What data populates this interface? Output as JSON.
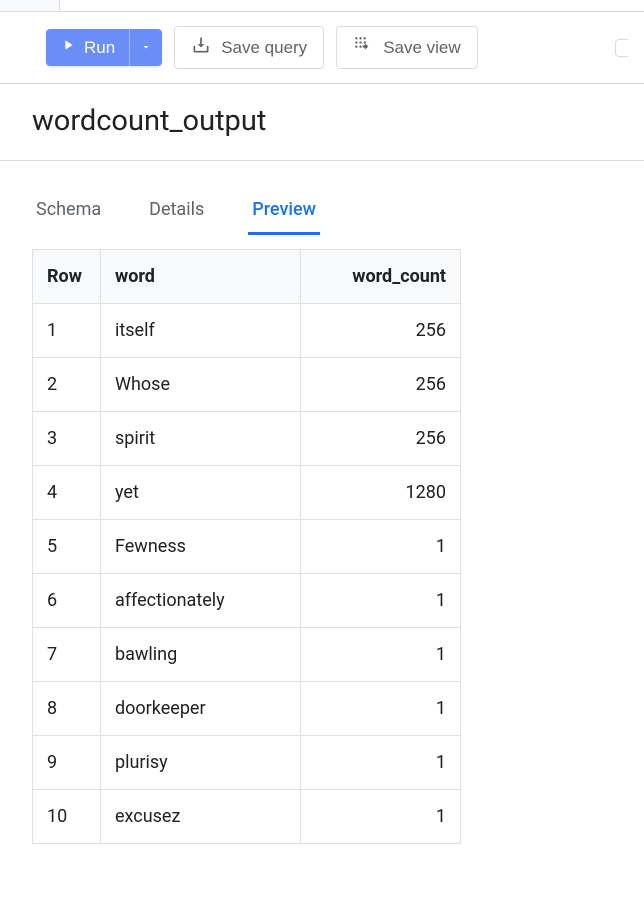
{
  "toolbar": {
    "run_label": "Run",
    "save_query_label": "Save query",
    "save_view_label": "Save view"
  },
  "title": "wordcount_output",
  "tabs": [
    {
      "label": "Schema",
      "active": false
    },
    {
      "label": "Details",
      "active": false
    },
    {
      "label": "Preview",
      "active": true
    }
  ],
  "table": {
    "headers": {
      "row": "Row",
      "word": "word",
      "word_count": "word_count"
    },
    "rows": [
      {
        "n": "1",
        "word": "itself",
        "count": "256"
      },
      {
        "n": "2",
        "word": "Whose",
        "count": "256"
      },
      {
        "n": "3",
        "word": "spirit",
        "count": "256"
      },
      {
        "n": "4",
        "word": "yet",
        "count": "1280"
      },
      {
        "n": "5",
        "word": "Fewness",
        "count": "1"
      },
      {
        "n": "6",
        "word": "affectionately",
        "count": "1"
      },
      {
        "n": "7",
        "word": "bawling",
        "count": "1"
      },
      {
        "n": "8",
        "word": "doorkeeper",
        "count": "1"
      },
      {
        "n": "9",
        "word": "plurisy",
        "count": "1"
      },
      {
        "n": "10",
        "word": "excusez",
        "count": "1"
      }
    ]
  }
}
